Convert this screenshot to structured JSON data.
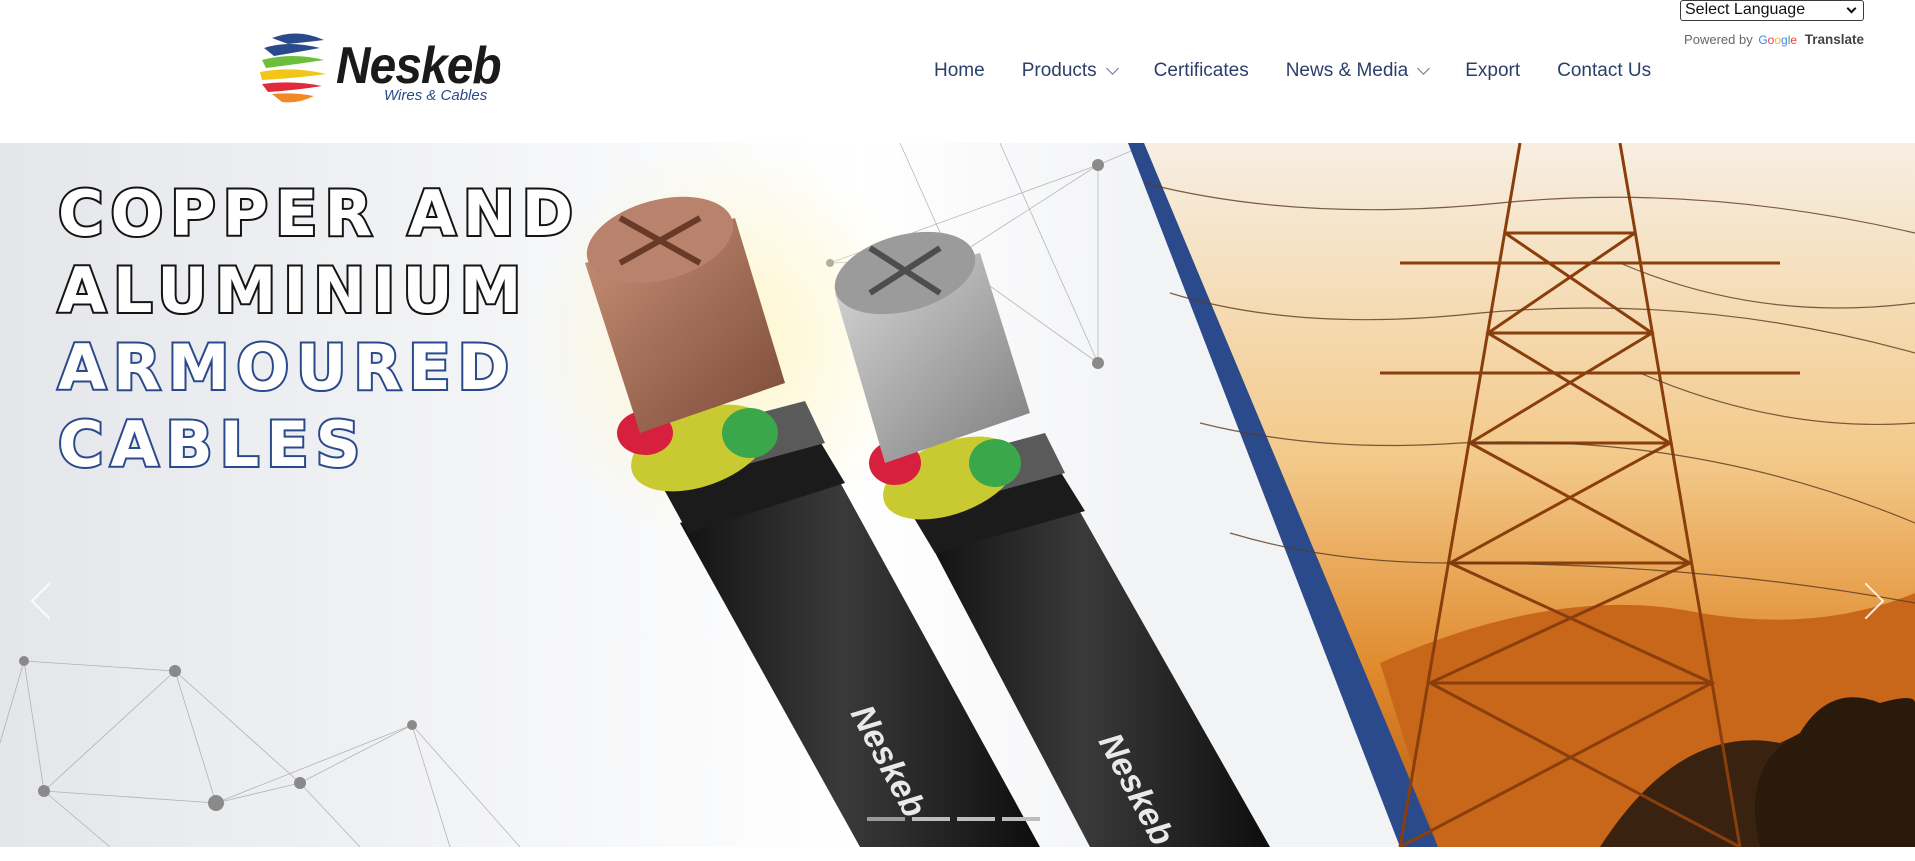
{
  "brand": {
    "name": "Neskeb",
    "tagline": "Wires & Cables"
  },
  "nav": {
    "items": [
      {
        "label": "Home",
        "has_dropdown": false
      },
      {
        "label": "Products",
        "has_dropdown": true
      },
      {
        "label": "Certificates",
        "has_dropdown": false
      },
      {
        "label": "News & Media",
        "has_dropdown": true
      },
      {
        "label": "Export",
        "has_dropdown": false
      },
      {
        "label": "Contact Us",
        "has_dropdown": false
      }
    ]
  },
  "translate": {
    "select_value": "Select Language",
    "powered_by": "Powered by",
    "google": "Google",
    "translate_label": "Translate"
  },
  "hero": {
    "headline_lines": [
      "COPPER AND",
      "ALUMINIUM",
      "ARMOURED",
      "CABLES"
    ],
    "cable_brand": "Neskeb",
    "slide_count": 4,
    "active_slide": 1
  },
  "colors": {
    "nav_text": "#2b3f6b",
    "brand_blue": "#2b4a8c",
    "headline_dark": "#141414",
    "sunset_orange": "#d9761f"
  }
}
